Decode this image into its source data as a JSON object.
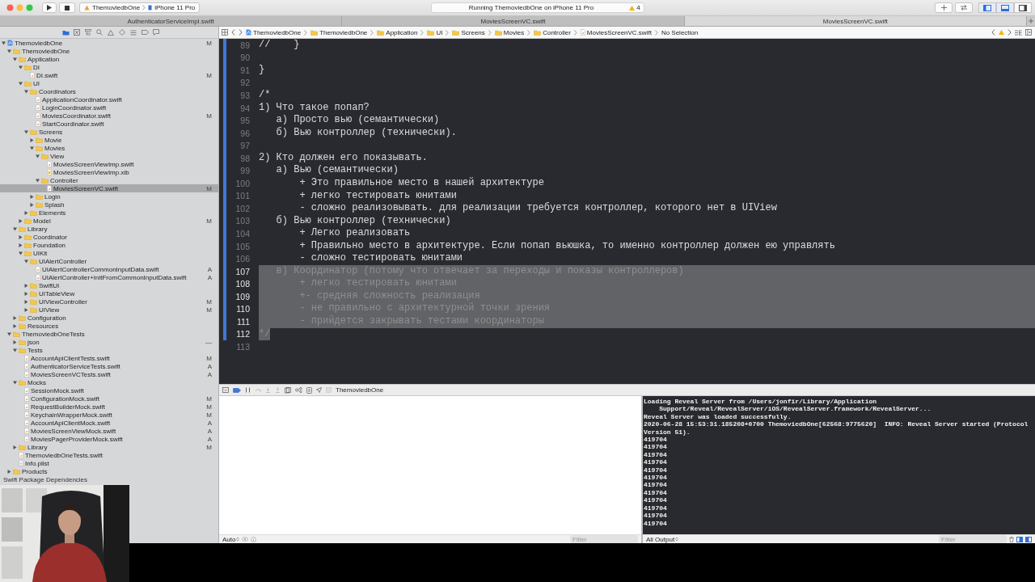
{
  "toolbar": {
    "scheme": "ThemoviedbOne",
    "device": "iPhone 11 Pro",
    "status": "Running ThemoviedbOne on iPhone 11 Pro",
    "warning_count": "4",
    "layout_toggles": [
      {
        "kind": "navigator",
        "on": true
      },
      {
        "kind": "debug",
        "on": true
      },
      {
        "kind": "inspector",
        "on": false
      }
    ]
  },
  "tabs": [
    {
      "label": "AuthenticatorServiceImpl.swift",
      "selected": false
    },
    {
      "label": "MoviesScreenVC.swift",
      "selected": false
    },
    {
      "label": "MoviesScreenVC.swift",
      "selected": true
    }
  ],
  "navigator": {
    "tabs": [
      {
        "kind": "project",
        "selected": true
      },
      {
        "kind": "source_control",
        "selected": false
      },
      {
        "kind": "symbols",
        "selected": false
      },
      {
        "kind": "find",
        "selected": false
      },
      {
        "kind": "issues",
        "selected": false
      },
      {
        "kind": "tests",
        "selected": false
      },
      {
        "kind": "debug",
        "selected": false
      },
      {
        "kind": "breakpoints",
        "selected": false
      },
      {
        "kind": "reports",
        "selected": false
      }
    ],
    "tree": [
      {
        "label": "ThemoviedbOne",
        "kind": "project",
        "expanded": true,
        "selected": false,
        "badge": "M",
        "children": [
          {
            "label": "ThemoviedbOne",
            "kind": "folder",
            "expanded": true,
            "selected": false,
            "children": [
              {
                "label": "Application",
                "kind": "folder",
                "expanded": true,
                "selected": false,
                "children": [
                  {
                    "label": "DI",
                    "kind": "folder",
                    "expanded": true,
                    "selected": false,
                    "children": [
                      {
                        "label": "DI.swift",
                        "kind": "swift",
                        "selected": false,
                        "badge": "M"
                      }
                    ]
                  },
                  {
                    "label": "UI",
                    "kind": "folder",
                    "expanded": true,
                    "selected": false,
                    "children": [
                      {
                        "label": "Coordinators",
                        "kind": "folder",
                        "expanded": true,
                        "selected": false,
                        "children": [
                          {
                            "label": "ApplicationCoordinator.swift",
                            "kind": "swift",
                            "selected": false
                          },
                          {
                            "label": "LoginCoordinator.swift",
                            "kind": "swift",
                            "selected": false
                          },
                          {
                            "label": "MoviesCoordinator.swift",
                            "kind": "swift",
                            "selected": false,
                            "badge": "M"
                          },
                          {
                            "label": "StartCoordinator.swift",
                            "kind": "swift",
                            "selected": false
                          }
                        ]
                      },
                      {
                        "label": "Screens",
                        "kind": "folder",
                        "expanded": true,
                        "selected": false,
                        "children": [
                          {
                            "label": "Movie",
                            "kind": "folder",
                            "expanded": false,
                            "selected": false
                          },
                          {
                            "label": "Movies",
                            "kind": "folder",
                            "expanded": true,
                            "selected": false,
                            "children": [
                              {
                                "label": "View",
                                "kind": "folder",
                                "expanded": true,
                                "selected": false,
                                "children": [
                                  {
                                    "label": "MoviesScreenViewImp.swift",
                                    "kind": "swift",
                                    "selected": false
                                  },
                                  {
                                    "label": "MoviesScreenViewImp.xib",
                                    "kind": "xib",
                                    "selected": false
                                  }
                                ]
                              },
                              {
                                "label": "Controller",
                                "kind": "folder",
                                "expanded": true,
                                "selected": false,
                                "children": [
                                  {
                                    "label": "MoviesScreenVC.swift",
                                    "kind": "swift",
                                    "selected": true,
                                    "badge": "M"
                                  }
                                ]
                              }
                            ]
                          },
                          {
                            "label": "Login",
                            "kind": "folder",
                            "expanded": false,
                            "selected": false
                          },
                          {
                            "label": "Splash",
                            "kind": "folder",
                            "expanded": false,
                            "selected": false
                          }
                        ]
                      },
                      {
                        "label": "Elements",
                        "kind": "folder",
                        "expanded": false,
                        "selected": false
                      }
                    ]
                  },
                  {
                    "label": "Model",
                    "kind": "folder",
                    "expanded": false,
                    "selected": false,
                    "badge": "M"
                  }
                ]
              },
              {
                "label": "Library",
                "kind": "folder",
                "expanded": true,
                "selected": false,
                "children": [
                  {
                    "label": "Coordinator",
                    "kind": "folder",
                    "expanded": false,
                    "selected": false
                  },
                  {
                    "label": "Foundation",
                    "kind": "folder",
                    "expanded": false,
                    "selected": false
                  },
                  {
                    "label": "UIKit",
                    "kind": "folder",
                    "expanded": true,
                    "selected": false,
                    "children": [
                      {
                        "label": "UIAlertController",
                        "kind": "folder",
                        "expanded": true,
                        "selected": false,
                        "children": [
                          {
                            "label": "UIAlertControllerCommonInputData.swift",
                            "kind": "swift",
                            "selected": false,
                            "badge": "A"
                          },
                          {
                            "label": "UIAlertController+InitFromCommonInputData.swift",
                            "kind": "swift",
                            "selected": false,
                            "badge": "A"
                          }
                        ]
                      },
                      {
                        "label": "SwiftUI",
                        "kind": "folder",
                        "expanded": false,
                        "selected": false
                      },
                      {
                        "label": "UITableView",
                        "kind": "folder",
                        "expanded": false,
                        "selected": false
                      },
                      {
                        "label": "UIViewController",
                        "kind": "folder",
                        "expanded": false,
                        "selected": false,
                        "badge": "M"
                      },
                      {
                        "label": "UIView",
                        "kind": "folder",
                        "expanded": false,
                        "selected": false,
                        "badge": "M"
                      }
                    ]
                  }
                ]
              },
              {
                "label": "Configuration",
                "kind": "folder",
                "expanded": false,
                "selected": false
              },
              {
                "label": "Resources",
                "kind": "folder",
                "expanded": false,
                "selected": false
              }
            ]
          },
          {
            "label": "ThemoviedbOneTests",
            "kind": "folder",
            "expanded": true,
            "selected": false,
            "children": [
              {
                "label": "json",
                "kind": "folder",
                "expanded": false,
                "selected": false,
                "badge": "—"
              },
              {
                "label": "Tests",
                "kind": "folder",
                "expanded": true,
                "selected": false,
                "children": [
                  {
                    "label": "AccountApiClientTests.swift",
                    "kind": "swift",
                    "selected": false,
                    "badge": "M"
                  },
                  {
                    "label": "AuthenticatorServiceTests.swift",
                    "kind": "swift",
                    "selected": false,
                    "badge": "A"
                  },
                  {
                    "label": "MoviesScreenVCTests.swift",
                    "kind": "swift",
                    "selected": false,
                    "badge": "A"
                  }
                ]
              },
              {
                "label": "Mocks",
                "kind": "folder",
                "expanded": true,
                "selected": false,
                "children": [
                  {
                    "label": "SessionMock.swift",
                    "kind": "swift",
                    "selected": false
                  },
                  {
                    "label": "ConfigurationMock.swift",
                    "kind": "swift",
                    "selected": false,
                    "badge": "M"
                  },
                  {
                    "label": "RequestBuilderMock.swift",
                    "kind": "swift",
                    "selected": false,
                    "badge": "M"
                  },
                  {
                    "label": "KeychainWrapperMock.swift",
                    "kind": "swift",
                    "selected": false,
                    "badge": "M"
                  },
                  {
                    "label": "AccountApiClientMock.swift",
                    "kind": "swift",
                    "selected": false,
                    "badge": "A"
                  },
                  {
                    "label": "MoviesScreenViewMock.swift",
                    "kind": "swift",
                    "selected": false,
                    "badge": "A"
                  },
                  {
                    "label": "MoviesPagerProviderMock.swift",
                    "kind": "swift",
                    "selected": false,
                    "badge": "A"
                  }
                ]
              },
              {
                "label": "Library",
                "kind": "folder",
                "expanded": false,
                "selected": false,
                "badge": "M"
              },
              {
                "label": "ThemoviedbOneTests.swift",
                "kind": "swift",
                "selected": false
              },
              {
                "label": "Info.plist",
                "kind": "plist",
                "selected": false
              }
            ]
          },
          {
            "label": "Products",
            "kind": "folder",
            "expanded": false,
            "selected": false
          }
        ]
      }
    ],
    "footer": "Swift Package Dependencies"
  },
  "breadcrumbs": [
    {
      "label": "ThemoviedbOne",
      "kind": "project"
    },
    {
      "label": "ThemoviedbOne",
      "kind": "folder"
    },
    {
      "label": "Application",
      "kind": "folder"
    },
    {
      "label": "UI",
      "kind": "folder"
    },
    {
      "label": "Screens",
      "kind": "folder"
    },
    {
      "label": "Movies",
      "kind": "folder"
    },
    {
      "label": "Controller",
      "kind": "folder"
    },
    {
      "label": "MoviesScreenVC.swift",
      "kind": "swift"
    },
    {
      "label": "No Selection",
      "kind": "text"
    }
  ],
  "editor": {
    "lines": [
      {
        "number": "89",
        "text": "//    }",
        "changed": true,
        "selected": false
      },
      {
        "number": "90",
        "changed": true,
        "selected": false
      },
      {
        "number": "91",
        "text": "}",
        "changed": true,
        "selected": false
      },
      {
        "number": "92",
        "changed": true,
        "selected": false
      },
      {
        "number": "93",
        "text": "/*",
        "changed": true,
        "selected": false
      },
      {
        "number": "94",
        "text": "1) Что такое попап?",
        "changed": true,
        "selected": false
      },
      {
        "number": "95",
        "text": "   а) Просто вью (семантически)",
        "changed": true,
        "selected": false
      },
      {
        "number": "96",
        "text": "   б) Вью контроллер (технически).",
        "changed": true,
        "selected": false
      },
      {
        "number": "97",
        "changed": true,
        "selected": false
      },
      {
        "number": "98",
        "text": "2) Кто должен его показывать.",
        "changed": true,
        "selected": false
      },
      {
        "number": "99",
        "text": "   а) Вью (семантически)",
        "changed": true,
        "selected": false
      },
      {
        "number": "100",
        "text": "       + Это правильное место в нашей архитектуре",
        "changed": true,
        "selected": false
      },
      {
        "number": "101",
        "text": "       + легко тестировать юнитами",
        "changed": true,
        "selected": false
      },
      {
        "number": "102",
        "text": "       - сложно реализовывать. для реализации требуется контроллер, которого нет в UIView",
        "changed": true,
        "selected": false
      },
      {
        "number": "103",
        "text": "   б) Вью контроллер (технически)",
        "changed": true,
        "selected": false
      },
      {
        "number": "104",
        "text": "       + Легко реализовать",
        "changed": true,
        "selected": false
      },
      {
        "number": "105",
        "text": "       + Правильно место в архитектуре. Если попап вьюшка, то именно контроллер должен ею управлять",
        "changed": true,
        "selected": false
      },
      {
        "number": "106",
        "text": "       - сложно тестировать юнитами",
        "changed": true,
        "selected": false
      },
      {
        "number": "107",
        "text": "   в) Координатор (потому что отвечает за переходы и показы контроллеров)",
        "changed": true,
        "selected": true
      },
      {
        "number": "108",
        "text": "       + легко тестировать юнитами",
        "changed": true,
        "selected": true
      },
      {
        "number": "109",
        "text": "       +- средняя сложность реализация",
        "changed": true,
        "selected": true
      },
      {
        "number": "110",
        "text": "       - не правильно с архитектурной точки зрения",
        "changed": true,
        "selected": true
      },
      {
        "number": "111",
        "text": "       - прийдется закрывать тестами координаторы",
        "changed": true,
        "selected": true
      },
      {
        "number": "112",
        "text": "*/",
        "changed": true,
        "selected": true
      },
      {
        "number": "113",
        "changed": false,
        "selected": false
      }
    ]
  },
  "debug_bar": {
    "breakpoints_active": true,
    "target": "ThemoviedbOne"
  },
  "variables": {
    "scope": "Auto",
    "filter_placeholder": "Filter"
  },
  "console": {
    "lines": [
      "Loading Reveal Server from /Users/jonfir/Library/Application",
      "    Support/Reveal/RevealServer/iOS/RevealServer.framework/RevealServer...",
      "Reveal Server was loaded successfully.",
      "2020-06-28 15:53:31.185208+0700 ThemoviedbOne[62568:9775620]  INFO: Reveal Server started (Protocol Version 51).",
      "419704",
      "419704",
      "419704",
      "419704",
      "419704",
      "419704",
      "419704",
      "419704",
      "419704",
      "419704",
      "419704",
      "419704"
    ],
    "output": "All Output",
    "filter_placeholder": "Filter"
  }
}
